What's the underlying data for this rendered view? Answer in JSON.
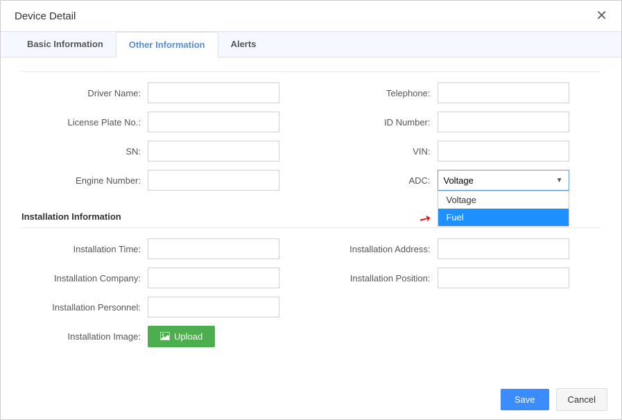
{
  "title": "Device Detail",
  "tabs": {
    "basic": "Basic Information",
    "other": "Other Information",
    "alerts": "Alerts"
  },
  "labels": {
    "driver_name": "Driver Name:",
    "license_plate": "License Plate No.:",
    "sn": "SN:",
    "engine_number": "Engine Number:",
    "telephone": "Telephone:",
    "id_number": "ID Number:",
    "vin": "VIN:",
    "adc": "ADC:",
    "install_time": "Installation Time:",
    "install_company": "Installation Company:",
    "install_personnel": "Installation Personnel:",
    "install_image": "Installation Image:",
    "install_address": "Installation Address:",
    "install_position": "Installation Position:"
  },
  "values": {
    "driver_name": "",
    "license_plate": "",
    "sn": "",
    "engine_number": "",
    "telephone": "",
    "id_number": "",
    "vin": "",
    "adc_selected": "Voltage",
    "install_time": "",
    "install_company": "",
    "install_personnel": "",
    "install_address": "",
    "install_position": ""
  },
  "adc_options": {
    "opt0": "Voltage",
    "opt1": "Fuel"
  },
  "sections": {
    "installation": "Installation Information"
  },
  "buttons": {
    "upload": "Upload",
    "save": "Save",
    "cancel": "Cancel"
  }
}
